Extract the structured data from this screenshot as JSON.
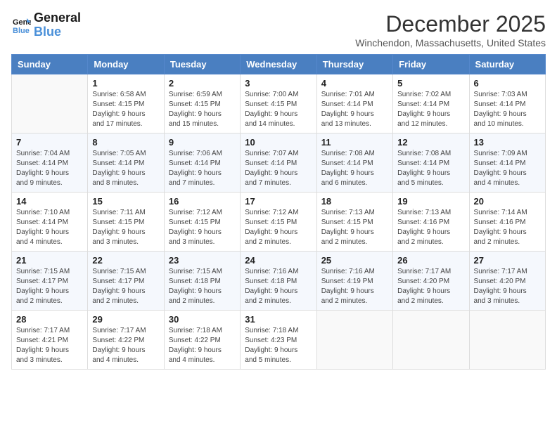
{
  "logo": {
    "line1": "General",
    "line2": "Blue"
  },
  "title": "December 2025",
  "location": "Winchendon, Massachusetts, United States",
  "weekdays": [
    "Sunday",
    "Monday",
    "Tuesday",
    "Wednesday",
    "Thursday",
    "Friday",
    "Saturday"
  ],
  "weeks": [
    [
      {
        "day": "",
        "info": ""
      },
      {
        "day": "1",
        "info": "Sunrise: 6:58 AM\nSunset: 4:15 PM\nDaylight: 9 hours\nand 17 minutes."
      },
      {
        "day": "2",
        "info": "Sunrise: 6:59 AM\nSunset: 4:15 PM\nDaylight: 9 hours\nand 15 minutes."
      },
      {
        "day": "3",
        "info": "Sunrise: 7:00 AM\nSunset: 4:15 PM\nDaylight: 9 hours\nand 14 minutes."
      },
      {
        "day": "4",
        "info": "Sunrise: 7:01 AM\nSunset: 4:14 PM\nDaylight: 9 hours\nand 13 minutes."
      },
      {
        "day": "5",
        "info": "Sunrise: 7:02 AM\nSunset: 4:14 PM\nDaylight: 9 hours\nand 12 minutes."
      },
      {
        "day": "6",
        "info": "Sunrise: 7:03 AM\nSunset: 4:14 PM\nDaylight: 9 hours\nand 10 minutes."
      }
    ],
    [
      {
        "day": "7",
        "info": "Sunrise: 7:04 AM\nSunset: 4:14 PM\nDaylight: 9 hours\nand 9 minutes."
      },
      {
        "day": "8",
        "info": "Sunrise: 7:05 AM\nSunset: 4:14 PM\nDaylight: 9 hours\nand 8 minutes."
      },
      {
        "day": "9",
        "info": "Sunrise: 7:06 AM\nSunset: 4:14 PM\nDaylight: 9 hours\nand 7 minutes."
      },
      {
        "day": "10",
        "info": "Sunrise: 7:07 AM\nSunset: 4:14 PM\nDaylight: 9 hours\nand 7 minutes."
      },
      {
        "day": "11",
        "info": "Sunrise: 7:08 AM\nSunset: 4:14 PM\nDaylight: 9 hours\nand 6 minutes."
      },
      {
        "day": "12",
        "info": "Sunrise: 7:08 AM\nSunset: 4:14 PM\nDaylight: 9 hours\nand 5 minutes."
      },
      {
        "day": "13",
        "info": "Sunrise: 7:09 AM\nSunset: 4:14 PM\nDaylight: 9 hours\nand 4 minutes."
      }
    ],
    [
      {
        "day": "14",
        "info": "Sunrise: 7:10 AM\nSunset: 4:14 PM\nDaylight: 9 hours\nand 4 minutes."
      },
      {
        "day": "15",
        "info": "Sunrise: 7:11 AM\nSunset: 4:15 PM\nDaylight: 9 hours\nand 3 minutes."
      },
      {
        "day": "16",
        "info": "Sunrise: 7:12 AM\nSunset: 4:15 PM\nDaylight: 9 hours\nand 3 minutes."
      },
      {
        "day": "17",
        "info": "Sunrise: 7:12 AM\nSunset: 4:15 PM\nDaylight: 9 hours\nand 2 minutes."
      },
      {
        "day": "18",
        "info": "Sunrise: 7:13 AM\nSunset: 4:15 PM\nDaylight: 9 hours\nand 2 minutes."
      },
      {
        "day": "19",
        "info": "Sunrise: 7:13 AM\nSunset: 4:16 PM\nDaylight: 9 hours\nand 2 minutes."
      },
      {
        "day": "20",
        "info": "Sunrise: 7:14 AM\nSunset: 4:16 PM\nDaylight: 9 hours\nand 2 minutes."
      }
    ],
    [
      {
        "day": "21",
        "info": "Sunrise: 7:15 AM\nSunset: 4:17 PM\nDaylight: 9 hours\nand 2 minutes."
      },
      {
        "day": "22",
        "info": "Sunrise: 7:15 AM\nSunset: 4:17 PM\nDaylight: 9 hours\nand 2 minutes."
      },
      {
        "day": "23",
        "info": "Sunrise: 7:15 AM\nSunset: 4:18 PM\nDaylight: 9 hours\nand 2 minutes."
      },
      {
        "day": "24",
        "info": "Sunrise: 7:16 AM\nSunset: 4:18 PM\nDaylight: 9 hours\nand 2 minutes."
      },
      {
        "day": "25",
        "info": "Sunrise: 7:16 AM\nSunset: 4:19 PM\nDaylight: 9 hours\nand 2 minutes."
      },
      {
        "day": "26",
        "info": "Sunrise: 7:17 AM\nSunset: 4:20 PM\nDaylight: 9 hours\nand 2 minutes."
      },
      {
        "day": "27",
        "info": "Sunrise: 7:17 AM\nSunset: 4:20 PM\nDaylight: 9 hours\nand 3 minutes."
      }
    ],
    [
      {
        "day": "28",
        "info": "Sunrise: 7:17 AM\nSunset: 4:21 PM\nDaylight: 9 hours\nand 3 minutes."
      },
      {
        "day": "29",
        "info": "Sunrise: 7:17 AM\nSunset: 4:22 PM\nDaylight: 9 hours\nand 4 minutes."
      },
      {
        "day": "30",
        "info": "Sunrise: 7:18 AM\nSunset: 4:22 PM\nDaylight: 9 hours\nand 4 minutes."
      },
      {
        "day": "31",
        "info": "Sunrise: 7:18 AM\nSunset: 4:23 PM\nDaylight: 9 hours\nand 5 minutes."
      },
      {
        "day": "",
        "info": ""
      },
      {
        "day": "",
        "info": ""
      },
      {
        "day": "",
        "info": ""
      }
    ]
  ]
}
